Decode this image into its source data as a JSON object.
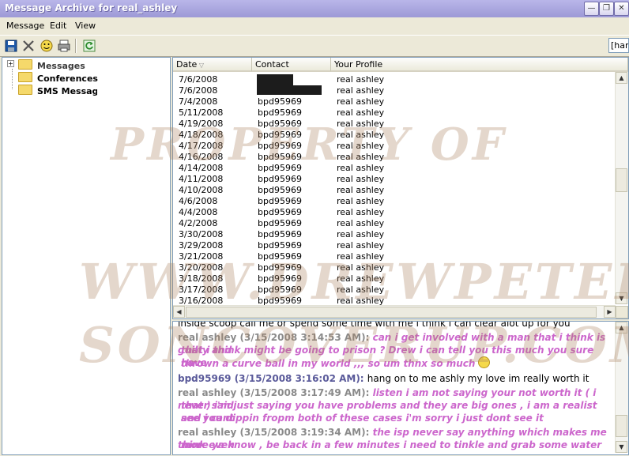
{
  "window": {
    "title": "Message Archive for real_ashley"
  },
  "menu": [
    "Message",
    "Edit",
    "View"
  ],
  "toolbar": {
    "icons": [
      "save-icon",
      "delete-icon",
      "emoticon-icon",
      "print-icon",
      "refresh-icon"
    ],
    "search_value": "[han"
  },
  "tree": {
    "items": [
      {
        "label": "Messages"
      },
      {
        "label": "Conferences"
      },
      {
        "label": "SMS Message"
      }
    ]
  },
  "list": {
    "columns": [
      "Date",
      "Contact",
      "Your Profile"
    ],
    "rows": [
      {
        "date": "7/6/2008",
        "contact": "",
        "profile": "real ashley",
        "redacted": true
      },
      {
        "date": "7/6/2008",
        "contact": "",
        "profile": "real ashley",
        "redacted": true
      },
      {
        "date": "7/4/2008",
        "contact": "bpd95969",
        "profile": "real ashley"
      },
      {
        "date": "5/11/2008",
        "contact": "bpd95969",
        "profile": "real ashley"
      },
      {
        "date": "4/19/2008",
        "contact": "bpd95969",
        "profile": "real ashley"
      },
      {
        "date": "4/18/2008",
        "contact": "bpd95969",
        "profile": "real ashley"
      },
      {
        "date": "4/17/2008",
        "contact": "bpd95969",
        "profile": "real ashley"
      },
      {
        "date": "4/16/2008",
        "contact": "bpd95969",
        "profile": "real ashley"
      },
      {
        "date": "4/14/2008",
        "contact": "bpd95969",
        "profile": "real ashley"
      },
      {
        "date": "4/11/2008",
        "contact": "bpd95969",
        "profile": "real ashley"
      },
      {
        "date": "4/10/2008",
        "contact": "bpd95969",
        "profile": "real ashley"
      },
      {
        "date": "4/6/2008",
        "contact": "bpd95969",
        "profile": "real ashley"
      },
      {
        "date": "4/4/2008",
        "contact": "bpd95969",
        "profile": "real ashley"
      },
      {
        "date": "4/2/2008",
        "contact": "bpd95969",
        "profile": "real ashley"
      },
      {
        "date": "3/30/2008",
        "contact": "bpd95969",
        "profile": "real ashley"
      },
      {
        "date": "3/29/2008",
        "contact": "bpd95969",
        "profile": "real ashley"
      },
      {
        "date": "3/21/2008",
        "contact": "bpd95969",
        "profile": "real ashley"
      },
      {
        "date": "3/20/2008",
        "contact": "bpd95969",
        "profile": "real ashley"
      },
      {
        "date": "3/18/2008",
        "contact": "bpd95969",
        "profile": "real ashley"
      },
      {
        "date": "3/17/2008",
        "contact": "bpd95969",
        "profile": "real ashley"
      },
      {
        "date": "3/16/2008",
        "contact": "bpd95969",
        "profile": "real ashley"
      }
    ]
  },
  "chat": {
    "lines": [
      {
        "kind": "plain",
        "text": "inside scoop call me or spend some time with me i think i can clear alot up for you"
      },
      {
        "kind": "sender",
        "who": "ashley",
        "sender": "real ashley (3/15/2008 3:14:53 AM): ",
        "text": "can i get involved with a man that i think is guilty and"
      },
      {
        "kind": "cont",
        "who": "ashley",
        "text": "that i think might be going to prison ? Drew i can tell you this much you sure have"
      },
      {
        "kind": "cont",
        "who": "ashley",
        "text": "thrown a curve ball in my world ,,, so um thnx so much",
        "emoji": true
      },
      {
        "kind": "sender",
        "who": "bpd",
        "sender": "bpd95969 (3/15/2008 3:16:02 AM): ",
        "text": "hang on to me ashly my love im really worth it"
      },
      {
        "kind": "sender",
        "who": "ashley",
        "sender": "real ashley (3/15/2008 3:17:49 AM): ",
        "text": "listen i am not saying your not worth it ( i never said"
      },
      {
        "kind": "cont",
        "who": "ashley",
        "text": "that ) i'm just saying you have problems and they are big ones , i am a realist and i cant"
      },
      {
        "kind": "cont",
        "who": "ashley",
        "text": "see you dippin fropm both of these cases i'm sorry i just dont see it"
      },
      {
        "kind": "sender",
        "who": "ashley",
        "sender": "real ashley (3/15/2008 3:19:34 AM): ",
        "text": "the isp never say anything which makes me think even"
      },
      {
        "kind": "cont",
        "who": "ashley",
        "text": "more ya know , be back in a few minutes i need to tinkle and grab some water"
      }
    ]
  },
  "watermark": {
    "line1": "PROPERTY OF",
    "line2": "WWW.DREWPETER",
    "line3": "SONCOVERUP.COM"
  },
  "colors": {
    "titlebar": "#a6a3dc",
    "chrome": "#ece9d8",
    "ashley_message": "#cc66cc",
    "ashley_sender": "#8a8a8a",
    "bpd_sender": "#5a5a9a"
  }
}
